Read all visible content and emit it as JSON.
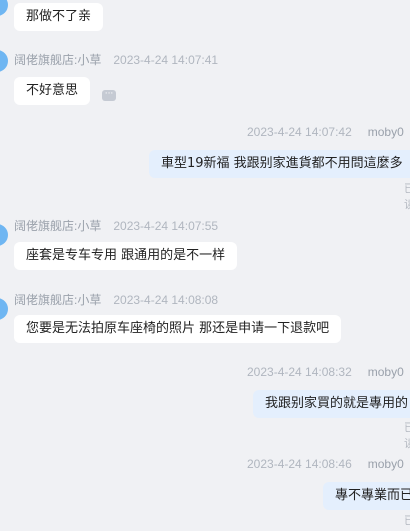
{
  "messages": [
    {
      "side": "left",
      "sender": "",
      "time": "",
      "text": "那做不了亲"
    },
    {
      "side": "left",
      "sender": "阔佬旗舰店:小草",
      "time": "2023-4-24 14:07:41",
      "text": "不好意思"
    },
    {
      "side": "right",
      "sender": "moby0",
      "time": "2023-4-24 14:07:42",
      "text": "車型19新福 我跟别家進貨都不用問這麼多",
      "status": "已读"
    },
    {
      "side": "left",
      "sender": "阔佬旗舰店:小草",
      "time": "2023-4-24 14:07:55",
      "text": "座套是专车专用 跟通用的是不一样"
    },
    {
      "side": "left",
      "sender": "阔佬旗舰店:小草",
      "time": "2023-4-24 14:08:08",
      "text": "您要是无法拍原车座椅的照片 那还是申请一下退款吧"
    },
    {
      "side": "right",
      "sender": "moby0",
      "time": "2023-4-24 14:08:32",
      "text": "我跟别家買的就是專用的",
      "status": "已读"
    },
    {
      "side": "right",
      "sender": "moby0",
      "time": "2023-4-24 14:08:46",
      "text": "專不專業而已",
      "status": "已读"
    }
  ],
  "icons": {
    "more": "more-dots-icon"
  },
  "colors": {
    "background": "#f0f1f4",
    "left_bubble": "#ffffff",
    "right_bubble": "#e4effd",
    "avatar": "#6fb6f2"
  }
}
